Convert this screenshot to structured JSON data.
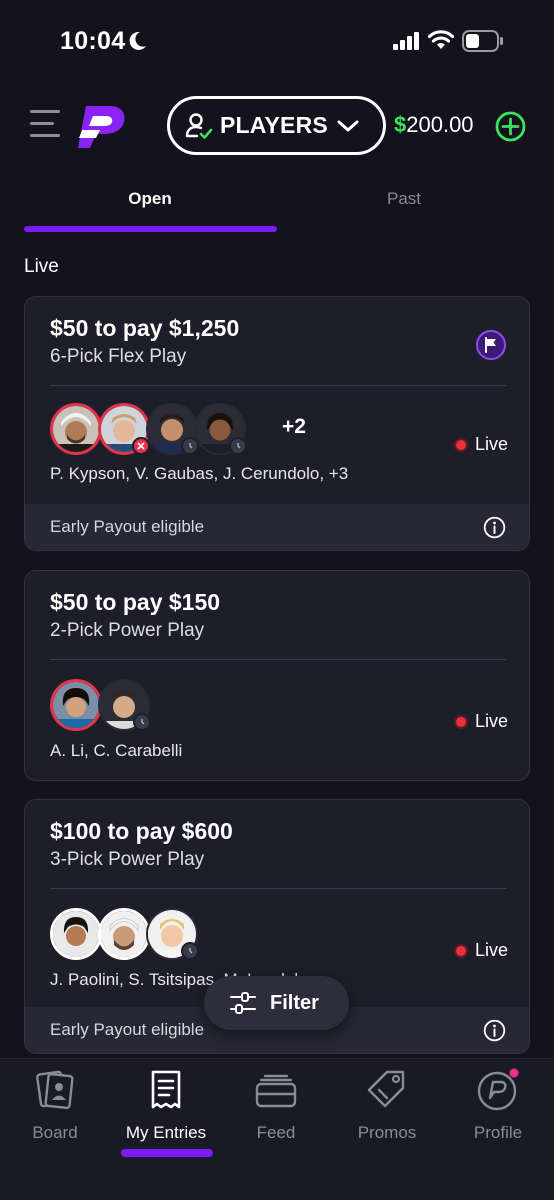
{
  "status_bar": {
    "time": "10:04"
  },
  "header": {
    "players_label": "PLAYERS",
    "balance_symbol": "$",
    "balance_amount": "200.00"
  },
  "tabs": [
    {
      "label": "Open",
      "active": true
    },
    {
      "label": "Past",
      "active": false
    }
  ],
  "section_label": "Live",
  "entries": [
    {
      "title": "$50 to pay $1,250",
      "subtitle": "6-Pick Flex Play",
      "extra_count": "+2",
      "status": "Live",
      "players": "P. Kypson, V. Gaubas, J. Cerundolo, +3",
      "footer": "Early Payout eligible"
    },
    {
      "title": "$50 to pay $150",
      "subtitle": "2-Pick Power Play",
      "status": "Live",
      "players": "A. Li, C. Carabelli"
    },
    {
      "title": "$100 to pay $600",
      "subtitle": "3-Pick Power Play",
      "status": "Live",
      "players": "J. Paolini, S. Tsitsipas, M. Landaluce",
      "footer": "Early Payout eligible"
    }
  ],
  "filter_label": "Filter",
  "bottom_nav": [
    {
      "label": "Board",
      "icon": "board-icon"
    },
    {
      "label": "My Entries",
      "icon": "entries-icon",
      "active": true
    },
    {
      "label": "Feed",
      "icon": "feed-icon"
    },
    {
      "label": "Promos",
      "icon": "promos-icon"
    },
    {
      "label": "Profile",
      "icon": "profile-icon"
    }
  ],
  "colors": {
    "accent_purple": "#7a1cf2",
    "balance_green": "#3be25b",
    "live_red": "#e8313f",
    "background": "#13121d",
    "card": "#1e1e2b"
  }
}
